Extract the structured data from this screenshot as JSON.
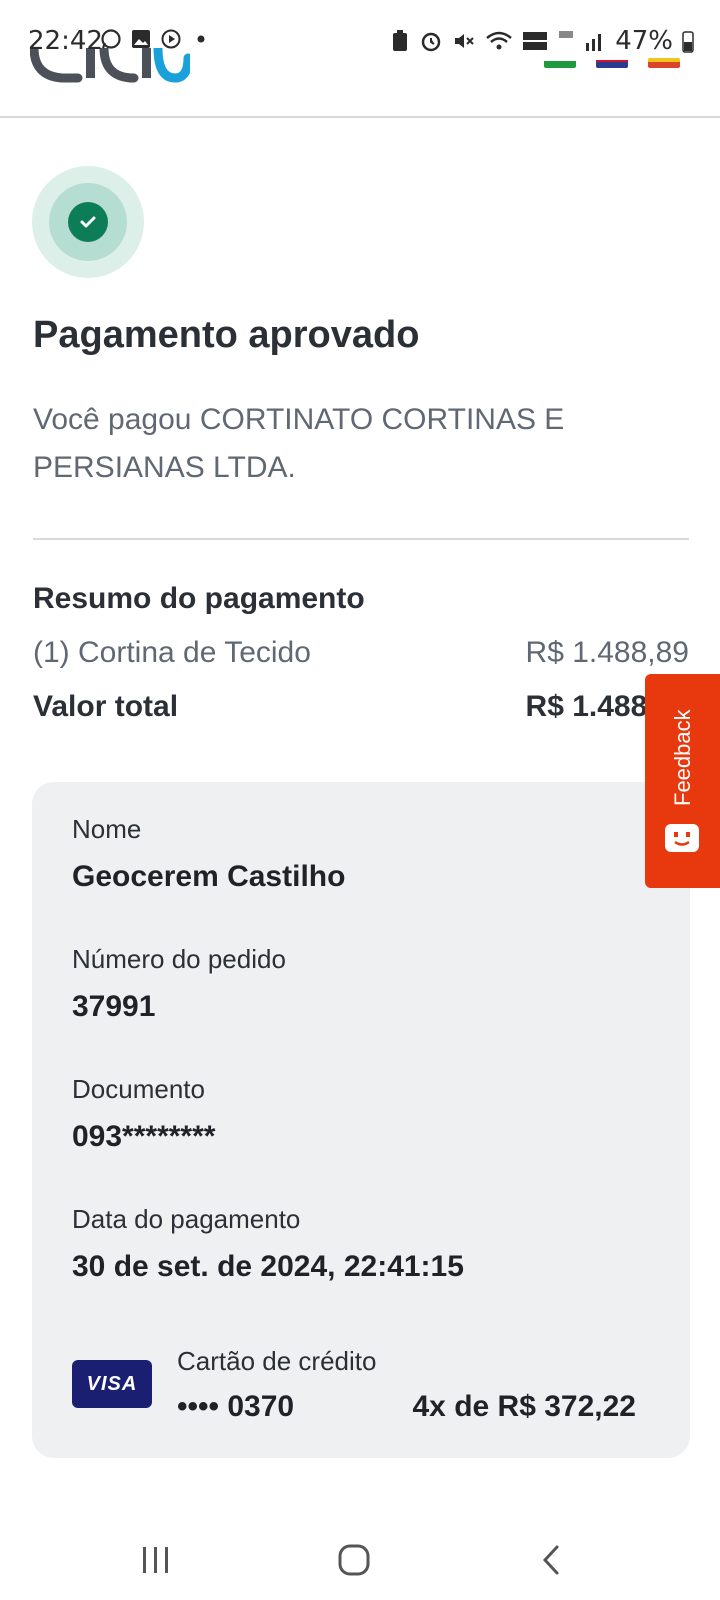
{
  "status_bar": {
    "time": "22:42",
    "battery_percent": "47%",
    "left_icons": [
      "whatsapp-icon",
      "image-icon",
      "play-store-icon",
      "dot-icon"
    ],
    "right_icons": [
      "battery-saver-icon",
      "alarm-icon",
      "mute-icon",
      "wifi-icon",
      "voz-wifi-icon",
      "4g-icon",
      "signal-icon",
      "battery-icon"
    ]
  },
  "header": {
    "logo": "cielo",
    "flags": [
      "brazil-flag",
      "uk-flag",
      "spain-flag"
    ]
  },
  "colors": {
    "success": "#0d7d57",
    "feedback": "#e8380d",
    "visa": "#1a1f71",
    "card_bg": "#eff0f2"
  },
  "result": {
    "title": "Pagamento aprovado",
    "message": "Você pagou CORTINATO CORTINAS E PERSIANAS LTDA."
  },
  "summary": {
    "title": "Resumo do pagamento",
    "item_label": "(1) Cortina de Tecido",
    "item_value": "R$ 1.488,89",
    "total_label": "Valor total",
    "total_value": "R$ 1.488,89"
  },
  "details": {
    "name_label": "Nome",
    "name_value": "Geocerem Castilho",
    "order_label": "Número do pedido",
    "order_value": "37991",
    "document_label": "Documento",
    "document_value": "093********",
    "date_label": "Data do pagamento",
    "date_value": "30 de set. de 2024, 22:41:15",
    "card_brand": "VISA",
    "payment_method": "Cartão de crédito",
    "card_number": "•••• 0370",
    "installments": "4x de R$ 372,22"
  },
  "feedback": {
    "label": "Feedback"
  },
  "navbar": {
    "buttons": [
      "recent-apps-icon",
      "home-icon",
      "back-icon"
    ]
  }
}
